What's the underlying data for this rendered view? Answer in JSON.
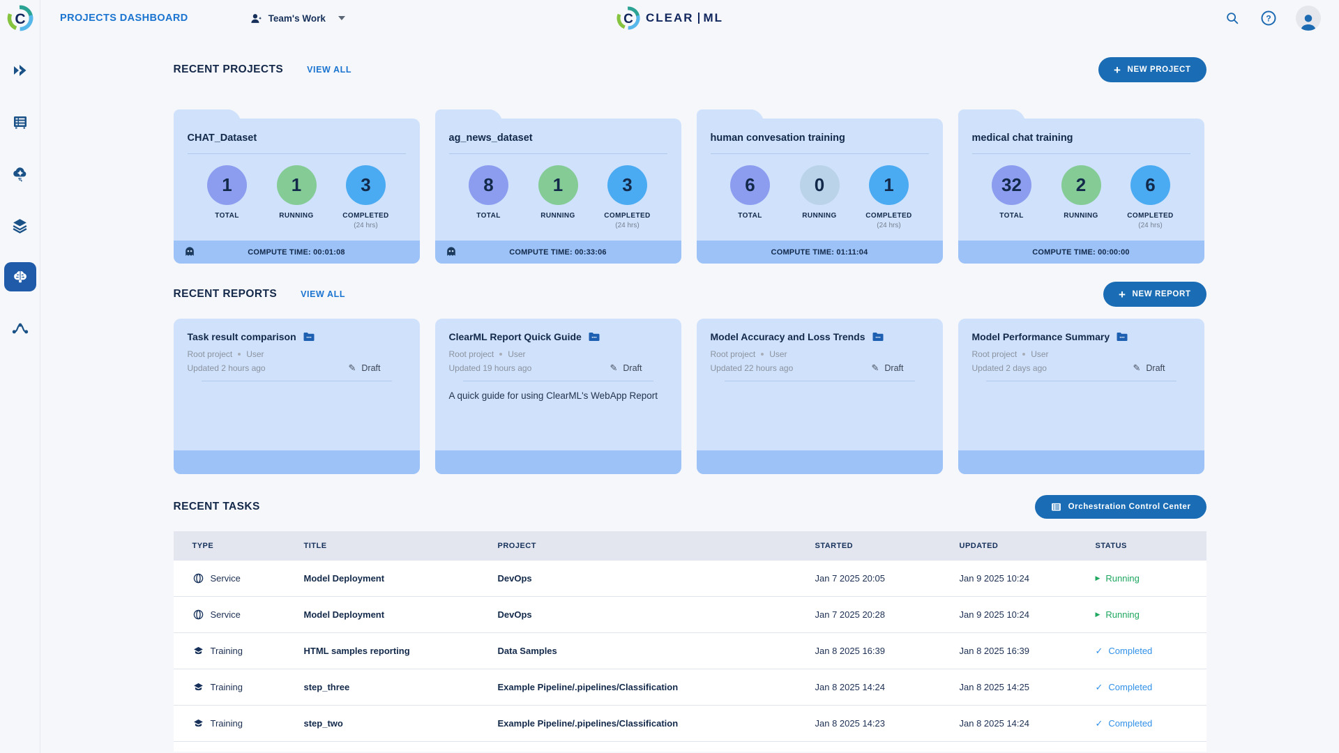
{
  "topbar": {
    "page_title": "PROJECTS DASHBOARD",
    "workspace": "Team's Work",
    "brand_left": "CLEAR",
    "brand_right": "ML",
    "icons": [
      "search-icon",
      "help-icon",
      "avatar"
    ]
  },
  "sidebar": {
    "items": [
      {
        "icon": "projects-icon",
        "active": false
      },
      {
        "icon": "queues-icon",
        "active": false
      },
      {
        "icon": "workers-icon",
        "active": false
      },
      {
        "icon": "datasets-icon",
        "active": false
      },
      {
        "icon": "models-brain-icon",
        "active": true
      },
      {
        "icon": "pipelines-icon",
        "active": false
      }
    ]
  },
  "projects": {
    "heading": "RECENT PROJECTS",
    "view_all": "VIEW ALL",
    "new_button": "NEW PROJECT",
    "labels": {
      "total": "TOTAL",
      "running": "RUNNING",
      "completed": "COMPLETED",
      "completed_sub": "(24 hrs)"
    },
    "cards": [
      {
        "title": "CHAT_Dataset",
        "total": "1",
        "running": "1",
        "completed": "3",
        "compute_time": "COMPUTE TIME: 00:01:08",
        "ghost": true
      },
      {
        "title": "ag_news_dataset",
        "total": "8",
        "running": "1",
        "completed": "3",
        "compute_time": "COMPUTE TIME: 00:33:06",
        "ghost": true
      },
      {
        "title": "human convesation training",
        "total": "6",
        "running": "0",
        "completed": "1",
        "compute_time": "COMPUTE TIME: 01:11:04",
        "ghost": false
      },
      {
        "title": "medical chat training",
        "total": "32",
        "running": "2",
        "completed": "6",
        "compute_time": "COMPUTE TIME: 00:00:00",
        "ghost": false
      }
    ]
  },
  "reports": {
    "heading": "RECENT REPORTS",
    "view_all": "VIEW ALL",
    "new_button": "NEW REPORT",
    "cards": [
      {
        "title": "Task result comparison",
        "project": "Root project",
        "user": "User",
        "updated": "Updated 2 hours ago",
        "status": "Draft",
        "description": ""
      },
      {
        "title": "ClearML Report Quick Guide",
        "project": "Root project",
        "user": "User",
        "updated": "Updated 19 hours ago",
        "status": "Draft",
        "description": "A quick guide for using ClearML's WebApp Report"
      },
      {
        "title": "Model Accuracy and Loss Trends",
        "project": "Root project",
        "user": "User",
        "updated": "Updated 22 hours ago",
        "status": "Draft",
        "description": ""
      },
      {
        "title": "Model Performance Summary",
        "project": "Root project",
        "user": "User",
        "updated": "Updated 2 days ago",
        "status": "Draft",
        "description": ""
      }
    ]
  },
  "tasks": {
    "heading": "RECENT TASKS",
    "button": "Orchestration Control Center",
    "columns": [
      "TYPE",
      "TITLE",
      "PROJECT",
      "STARTED",
      "UPDATED",
      "STATUS"
    ],
    "rows": [
      {
        "type": "Service",
        "title": "Model Deployment",
        "project": "DevOps",
        "started": "Jan 7 2025 20:05",
        "updated": "Jan 9 2025 10:24",
        "status": "Running"
      },
      {
        "type": "Service",
        "title": "Model Deployment",
        "project": "DevOps",
        "started": "Jan 7 2025 20:28",
        "updated": "Jan 9 2025 10:24",
        "status": "Running"
      },
      {
        "type": "Training",
        "title": "HTML samples reporting",
        "project": "Data Samples",
        "started": "Jan 8 2025 16:39",
        "updated": "Jan 8 2025 16:39",
        "status": "Completed"
      },
      {
        "type": "Training",
        "title": "step_three",
        "project": "Example Pipeline/.pipelines/Classification",
        "started": "Jan 8 2025 14:24",
        "updated": "Jan 8 2025 14:25",
        "status": "Completed"
      },
      {
        "type": "Training",
        "title": "step_two",
        "project": "Example Pipeline/.pipelines/Classification",
        "started": "Jan 8 2025 14:23",
        "updated": "Jan 8 2025 14:24",
        "status": "Completed"
      }
    ]
  },
  "colors": {
    "accent_blue": "#1a6cb5",
    "link_blue": "#1a74d0",
    "card_bg": "#cfe1fb",
    "card_footer": "#9cc2f7",
    "stat_total": "#8c9def",
    "stat_running": "#84cb96",
    "stat_running_zero": "#bad3e9",
    "stat_completed": "#4babf2",
    "status_running": "#1ea75f",
    "status_completed": "#2f90e8",
    "navy_text": "#13294a"
  }
}
